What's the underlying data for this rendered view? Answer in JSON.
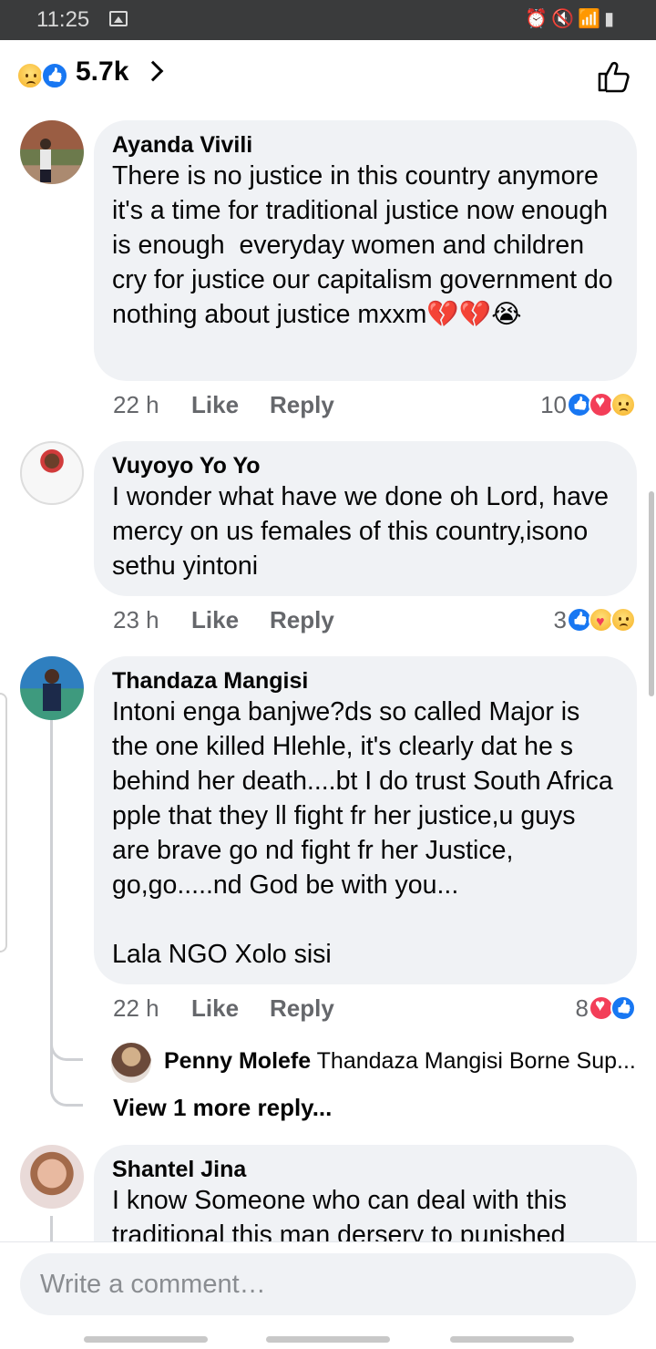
{
  "status_bar": {
    "time": "11:25"
  },
  "header": {
    "reaction_count": "5.7k"
  },
  "comments": [
    {
      "author": "Ayanda Vivili",
      "text": "There is no justice in this country anymore it's a time for traditional justice now enough is enough  everyday women and children cry for justice our capitalism government do nothing about justice mxxm💔💔😭",
      "time": "22 h",
      "like_label": "Like",
      "reply_label": "Reply",
      "reaction_count": "10",
      "reactions": [
        "like",
        "love",
        "sad"
      ]
    },
    {
      "author": "Vuyoyo Yo Yo",
      "text": "I wonder what have we done oh Lord, have mercy on us females of this country,isono sethu yintoni",
      "time": "23 h",
      "like_label": "Like",
      "reply_label": "Reply",
      "reaction_count": "3",
      "reactions": [
        "like",
        "care",
        "sad"
      ]
    },
    {
      "author": "Thandaza Mangisi",
      "text": "Intoni enga banjwe?ds so called Major is the one killed Hlehle, it's clearly dat he s behind her death....bt I do trust South Africa pple that they ll fight fr her justice,u guys are brave go nd fight fr her Justice, go,go.....nd God be with you...\n\nLala NGO Xolo sisi",
      "time": "22 h",
      "like_label": "Like",
      "reply_label": "Reply",
      "reaction_count": "8",
      "reactions": [
        "love",
        "like"
      ],
      "reply_preview": {
        "author": "Penny Molefe",
        "text": "Thandaza Mangisi Borne Sup..."
      },
      "view_more": "View 1 more reply..."
    },
    {
      "author": "Shantel Jina",
      "text": "I know Someone who can deal with this traditional this man dersery to punished"
    }
  ],
  "composer": {
    "placeholder": "Write a comment…"
  }
}
